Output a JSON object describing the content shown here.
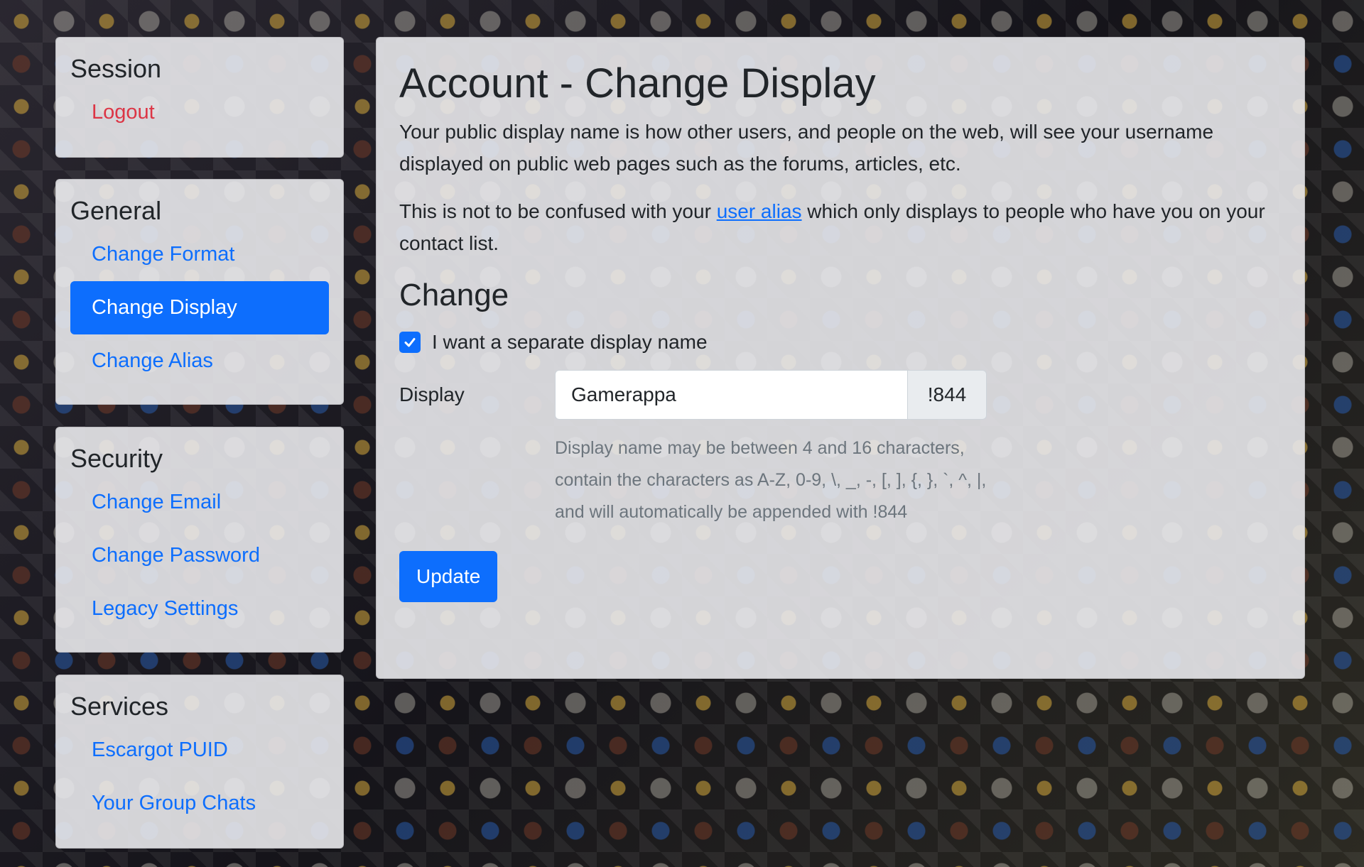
{
  "sidebar": {
    "session": {
      "title": "Session",
      "items": [
        {
          "label": "Logout"
        }
      ]
    },
    "general": {
      "title": "General",
      "items": [
        {
          "label": "Change Format"
        },
        {
          "label": "Change Display",
          "active": true
        },
        {
          "label": "Change Alias"
        }
      ]
    },
    "security": {
      "title": "Security",
      "items": [
        {
          "label": "Change Email"
        },
        {
          "label": "Change Password"
        },
        {
          "label": "Legacy Settings"
        }
      ]
    },
    "services": {
      "title": "Services",
      "items": [
        {
          "label": "Escargot PUID"
        },
        {
          "label": "Your Group Chats"
        }
      ]
    }
  },
  "main": {
    "title": "Account - Change Display",
    "intro": "Your public display name is how other users, and people on the web, will see your username displayed on public web pages such as the forums, articles, etc.",
    "note_prefix": "This is not to be confused with your ",
    "note_link": "user alias",
    "note_suffix": " which only displays to people who have you on your contact list.",
    "section_title": "Change",
    "checkbox_label": "I want a separate display name",
    "checkbox_checked": true,
    "display_label": "Display",
    "display_value": "Gamerappa",
    "display_suffix": "!844",
    "hint": "Display name may be between 4 and 16 characters, contain the characters as A-Z, 0-9, \\, _, -, [, ], {, }, `, ^, |, and will automatically be appended with !844",
    "submit_label": "Update"
  },
  "colors": {
    "primary": "#0d6efd",
    "danger": "#dc3545",
    "muted": "#6c757d"
  }
}
